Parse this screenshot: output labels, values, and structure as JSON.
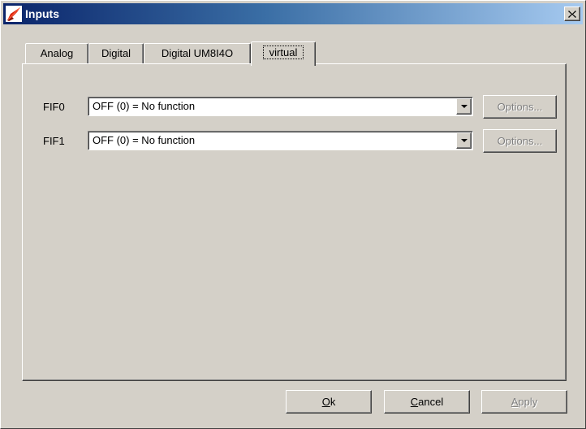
{
  "window": {
    "title": "Inputs",
    "title_icon": "app-icon",
    "close_icon": "close-icon"
  },
  "tabs": [
    {
      "label": "Analog",
      "selected": false
    },
    {
      "label": "Digital",
      "selected": false
    },
    {
      "label": "Digital UM8I4O",
      "selected": false
    },
    {
      "label": "virtual",
      "selected": true
    }
  ],
  "rows": [
    {
      "label": "FIF0",
      "value": "OFF (0) = No function",
      "options_label": "Options...",
      "options_enabled": false
    },
    {
      "label": "FIF1",
      "value": "OFF (0) = No function",
      "options_label": "Options...",
      "options_enabled": false
    }
  ],
  "footer": {
    "ok_label": "Ok",
    "cancel_label": "Cancel",
    "apply_label": "Apply",
    "apply_enabled": false
  },
  "colors": {
    "face": "#d4d0c8",
    "title_start": "#0a246a",
    "title_end": "#a6caf0",
    "disabled_text": "#808080"
  }
}
